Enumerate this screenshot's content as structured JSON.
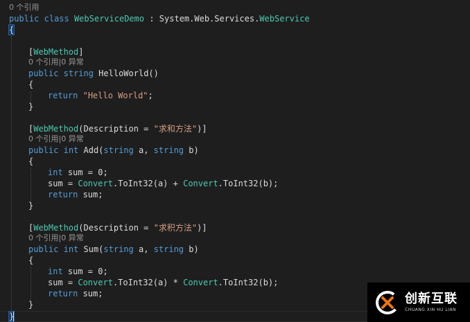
{
  "code": {
    "lens_class": "0 个引用",
    "class_decl": {
      "kw_public": "public",
      "kw_class": "class",
      "class_name": "WebServiceDemo",
      "colon": " : ",
      "base_ns": "System.Web.Services.",
      "base_type": "WebService"
    },
    "open_brace": "{",
    "close_brace": "}",
    "methods": [
      {
        "attr_open": "[",
        "attr_name": "WebMethod",
        "attr_args_open": "",
        "attr_desc": "",
        "attr_close": "]",
        "lens": "0 个引用|0 异常",
        "kw_public": "public",
        "ret_type": "string",
        "sig_rest": " HelloWorld()",
        "body": [
          {
            "kw": "return",
            "str": "\"Hello World\"",
            "rest": ";"
          }
        ]
      },
      {
        "attr_open": "[",
        "attr_name": "WebMethod",
        "attr_args_open": "(Description = ",
        "attr_desc": "\"求和方法\"",
        "attr_close": ")]",
        "lens": "0 个引用|0 异常",
        "kw_public": "public",
        "ret_type": "int",
        "method_name": " Add(",
        "param1_type": "string",
        "param1_name": " a, ",
        "param2_type": "string",
        "param2_name": " b)",
        "line1": {
          "type": "int",
          "rest": " sum = 0;"
        },
        "line2": {
          "pre": "sum = ",
          "conv1": "Convert",
          "mid1": ".ToInt32(a) + ",
          "conv2": "Convert",
          "mid2": ".ToInt32(b);"
        },
        "line3": {
          "kw": "return",
          "rest": " sum;"
        }
      },
      {
        "attr_open": "[",
        "attr_name": "WebMethod",
        "attr_args_open": "(Description = ",
        "attr_desc": "\"求积方法\"",
        "attr_close": ")]",
        "lens": "0 个引用|0 异常",
        "kw_public": "public",
        "ret_type": "int",
        "method_name": " Sum(",
        "param1_type": "string",
        "param1_name": " a, ",
        "param2_type": "string",
        "param2_name": " b)",
        "line1": {
          "type": "int",
          "rest": " sum = 0;"
        },
        "line2": {
          "pre": "sum = ",
          "conv1": "Convert",
          "mid1": ".ToInt32(a) * ",
          "conv2": "Convert",
          "mid2": ".ToInt32(b);"
        },
        "line3": {
          "kw": "return",
          "rest": " sum;"
        }
      }
    ]
  },
  "watermark": {
    "title": "创新互联",
    "subtitle": "CHUANG XIN HU LIAN"
  },
  "colors": {
    "background": "#1e1e1e",
    "keyword": "#569cd6",
    "type": "#4ec9b0",
    "string": "#d69d85",
    "text": "#dcdcdc",
    "codelens": "#999999"
  }
}
